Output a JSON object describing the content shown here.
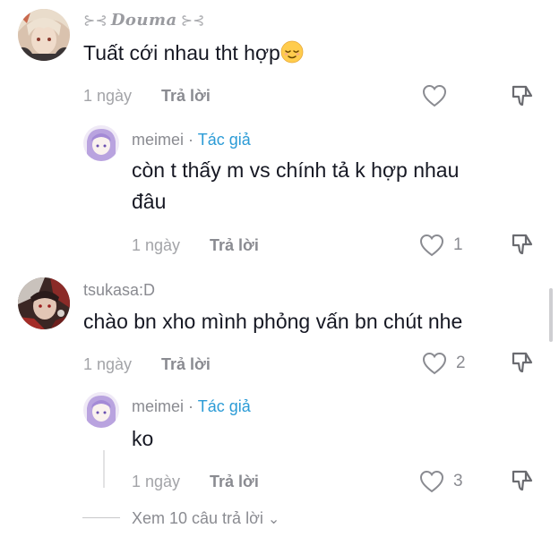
{
  "comments": [
    {
      "username": "Douma",
      "text": "Tuất cới nhau tht hợp",
      "time": "1 ngày",
      "reply_label": "Trả lời",
      "likes": ""
    },
    {
      "username": "meimei",
      "author_label": "Tác giả",
      "text_line1": "còn t thấy m vs chính tả k hợp nhau",
      "text_line2": "đâu",
      "time": "1 ngày",
      "reply_label": "Trả lời",
      "likes": "1"
    },
    {
      "username": "tsukasa:D",
      "text": "chào bn xho mình phỏng vấn bn chút nhe",
      "time": "1 ngày",
      "reply_label": "Trả lời",
      "likes": "2"
    },
    {
      "username": "meimei",
      "author_label": "Tác giả",
      "text": "ko",
      "time": "1 ngày",
      "reply_label": "Trả lời",
      "likes": "3"
    }
  ],
  "view_more_label": "Xem 10 câu trả lời",
  "separator": "·",
  "colors": {
    "author": "#2b9bd6",
    "meta": "#a3a4a8",
    "text": "#161823"
  },
  "icons": [
    "heart-icon",
    "dislike-icon",
    "chevron-down-icon",
    "relieved-emoji-icon"
  ]
}
